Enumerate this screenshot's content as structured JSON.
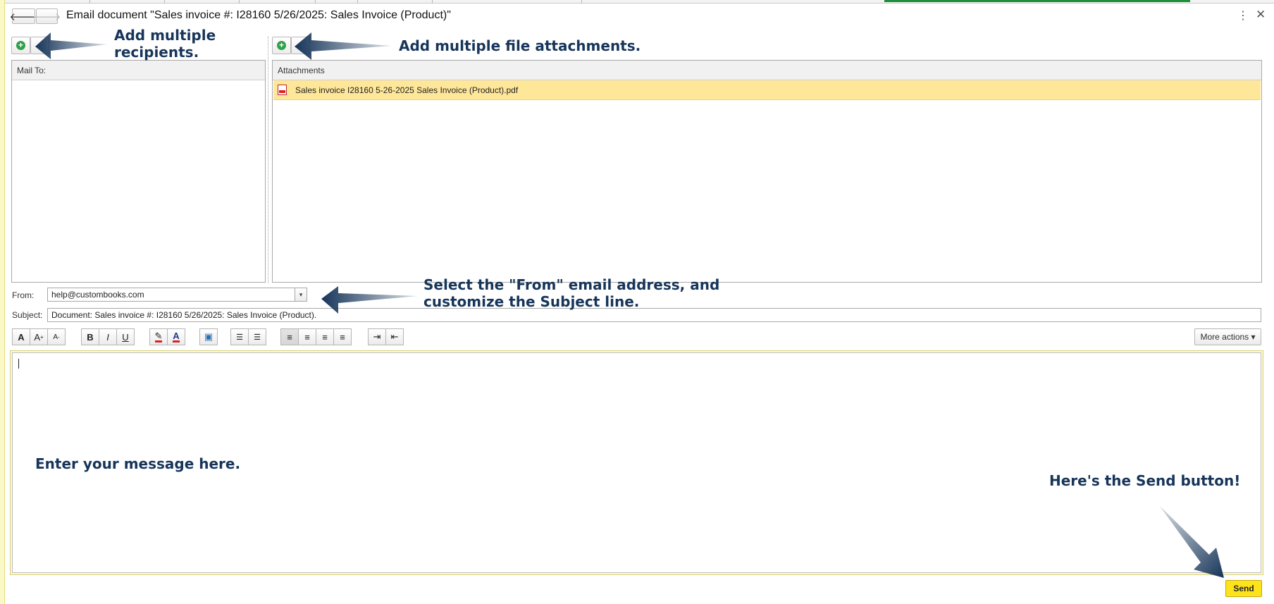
{
  "window": {
    "title": "Email document \"Sales invoice #: I28160 5/26/2025: Sales Invoice (Product)\"",
    "back_glyph": "🡐",
    "forward_glyph": "🡒",
    "menu_glyph": "⋮",
    "close_glyph": "✕"
  },
  "recipients": {
    "header": "Mail To:",
    "add_glyph": "+"
  },
  "attachments": {
    "header": "Attachments",
    "add_glyph": "+",
    "files": [
      {
        "name": "Sales invoice    I28160 5-26-2025  Sales Invoice (Product).pdf",
        "icon": "pdf-icon"
      }
    ]
  },
  "from": {
    "label": "From:",
    "value": "help@custombooks.com",
    "dropdown_glyph": "▾"
  },
  "subject": {
    "label": "Subject:",
    "value": "Document: Sales invoice #: I28160 5/26/2025: Sales Invoice (Product)."
  },
  "toolbar": {
    "font": "A",
    "grow": "A",
    "shrink": "A",
    "bold": "B",
    "italic": "I",
    "underline": "U",
    "highlight": "✎",
    "font_color": "A",
    "insert_image": "▣",
    "bullets": "☰",
    "numbers": "☰",
    "align_left": "≡",
    "align_center": "≡",
    "align_right": "≡",
    "justify": "≡",
    "indent": "⇥",
    "outdent": "⇤",
    "more_actions": "More actions ▾"
  },
  "send_label": "Send",
  "callouts": {
    "recipients": [
      "Add multiple",
      "recipients."
    ],
    "attachments": "Add multiple file attachments.",
    "from_subject": [
      "Select the \"From\" email address, and",
      "customize the Subject line."
    ],
    "message": "Enter your message here.",
    "send": "Here's the Send button!"
  },
  "colors": {
    "callout_text": "#17355a",
    "send_button": "#fde31b",
    "attachment_selected": "#ffe799",
    "add_icon": "#2fa04a"
  }
}
